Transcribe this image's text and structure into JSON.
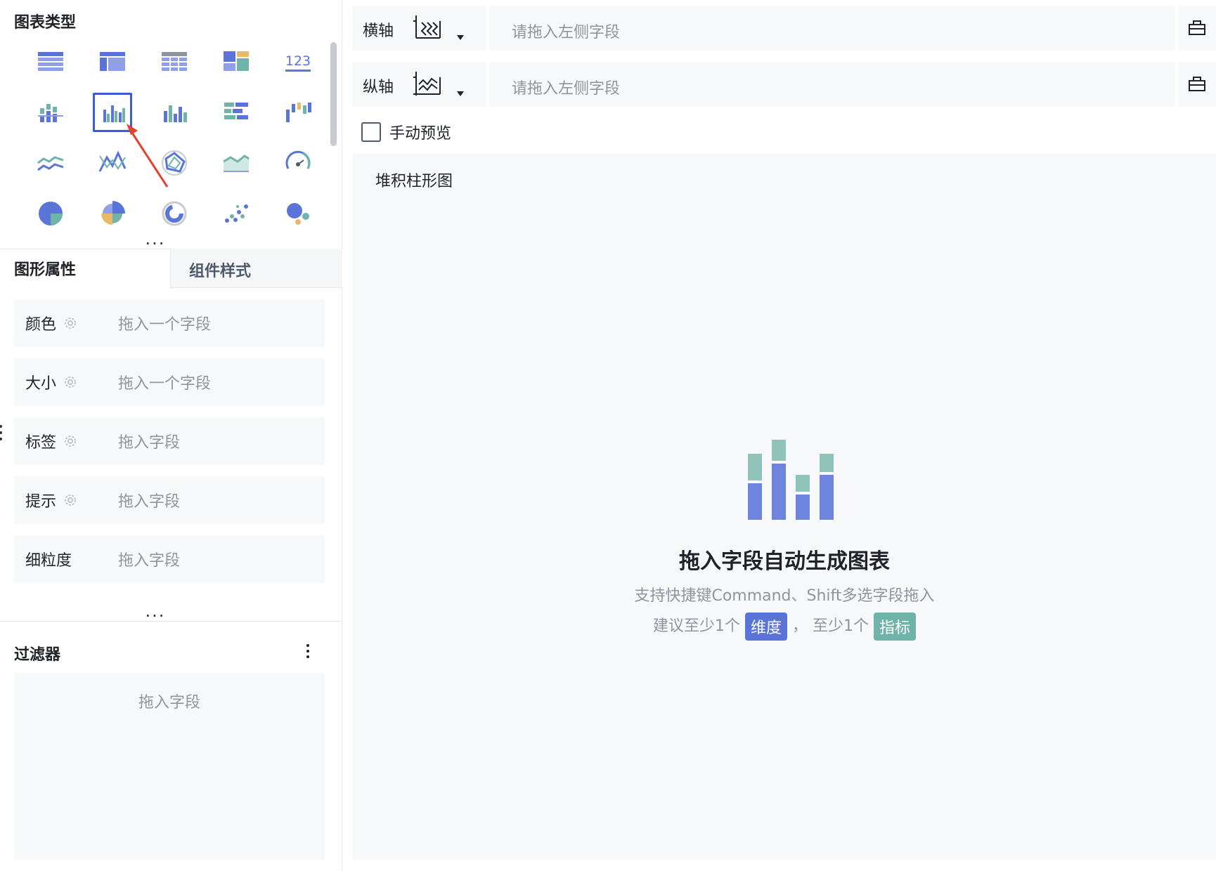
{
  "left": {
    "chart_type_title": "图表类型",
    "chart_icons": [
      "table-icon",
      "cross-table-icon",
      "detail-table-icon",
      "card-layout-icon",
      "number-indicator-icon",
      "stacked-column-icon",
      "grouped-column-icon",
      "column-icon",
      "bar-icon",
      "waterfall-icon",
      "line-icon",
      "multi-line-icon",
      "radar-icon",
      "area-icon",
      "gauge-icon",
      "pie-icon",
      "rose-pie-icon",
      "ring-icon",
      "scatter-icon",
      "bubble-icon"
    ],
    "selected_chart_index": 6,
    "number_indicator_text": "123",
    "tabs": {
      "shape_props": "图形属性",
      "component_style": "组件样式"
    },
    "props": [
      {
        "label": "颜色",
        "placeholder": "拖入一个字段",
        "gear": true
      },
      {
        "label": "大小",
        "placeholder": "拖入一个字段",
        "gear": true
      },
      {
        "label": "标签",
        "placeholder": "拖入字段",
        "gear": true
      },
      {
        "label": "提示",
        "placeholder": "拖入字段",
        "gear": true
      },
      {
        "label": "细粒度",
        "placeholder": "拖入字段",
        "gear": false
      }
    ],
    "filter": {
      "title": "过滤器",
      "placeholder": "拖入字段"
    }
  },
  "right": {
    "x_axis": {
      "label": "横轴",
      "placeholder": "请拖入左侧字段"
    },
    "y_axis": {
      "label": "纵轴",
      "placeholder": "请拖入左侧字段"
    },
    "manual_preview": {
      "label": "手动预览",
      "checked": false
    },
    "canvas": {
      "chart_name": "堆积柱形图",
      "empty_title": "拖入字段自动生成图表",
      "empty_hint": "支持快捷键Command、Shift多选字段拖入",
      "suggest_prefix": "建议至少1个",
      "dimension_tag": "维度",
      "separator": "，",
      "suggest_middle": "至少1个",
      "metric_tag": "指标"
    }
  },
  "colors": {
    "primary": "#5b74d8",
    "teal": "#6fb3a9",
    "gold": "#e8b86b",
    "select_border": "#3b5bdb",
    "arrow": "#e5402f"
  }
}
